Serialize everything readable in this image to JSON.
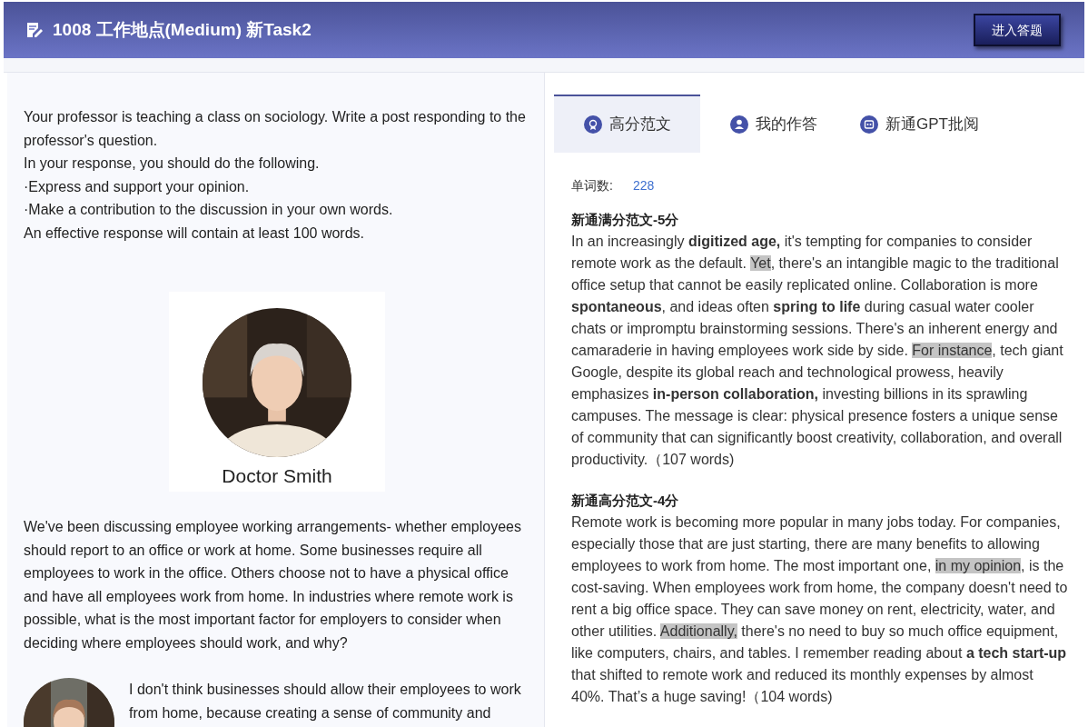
{
  "header": {
    "title": "1008 工作地点(Medium) 新Task2",
    "button": "进入答题"
  },
  "prompt": {
    "lines": [
      "Your professor is teaching a class on sociology. Write a post responding to the professor's question.",
      "In your response, you should do the following.",
      "·Express and support your opinion.",
      "·Make a contribution to the discussion in your own words.",
      "An effective response will contain at least 100 words."
    ],
    "professor": {
      "name": "Doctor Smith"
    },
    "question": "We've been discussing employee working arrangements- whether employees should report to an office or work at home. Some businesses require all employees to work in the office. Others choose not to have a physical office and have all employees work from home. In industries where remote work is possible, what is the most important factor for employers to consider when deciding where employees should work, and why?",
    "student_post": {
      "text": "I don't think businesses should allow their employees to work from home, because creating a sense of community and"
    }
  },
  "tabs": [
    {
      "label": "高分范文",
      "kind": "medal",
      "selected": true
    },
    {
      "label": "我的作答",
      "kind": "user",
      "selected": false
    },
    {
      "label": "新通GPT批阅",
      "kind": "robot",
      "selected": false
    }
  ],
  "word_count": {
    "label": "单词数:",
    "value": "228"
  },
  "essays": [
    {
      "title": "新通满分范文-5分",
      "segments": [
        {
          "kind": "text",
          "text": "In an increasingly "
        },
        {
          "kind": "bold",
          "text": "digitized age,"
        },
        {
          "kind": "text",
          "text": " it's tempting for companies to consider remote work as the default. "
        },
        {
          "kind": "highlight",
          "text": "Yet"
        },
        {
          "kind": "text",
          "text": ", there's an intangible magic to the traditional office setup that cannot be easily replicated online. Collaboration is more "
        },
        {
          "kind": "bold",
          "text": "spontaneous"
        },
        {
          "kind": "text",
          "text": ", and ideas often "
        },
        {
          "kind": "bold",
          "text": "spring to life"
        },
        {
          "kind": "text",
          "text": " during casual water cooler chats or impromptu brainstorming sessions. There's an inherent energy and camaraderie in having employees work side by side. "
        },
        {
          "kind": "highlight",
          "text": "For instance"
        },
        {
          "kind": "text",
          "text": ", tech giant Google, despite its global reach and technological prowess, heavily emphasizes "
        },
        {
          "kind": "bold",
          "text": "in-person collaboration,"
        },
        {
          "kind": "text",
          "text": " investing billions in its sprawling campuses. The message is clear: physical presence fosters a unique sense of community that can significantly boost creativity, collaboration, and overall productivity.（107 words)"
        }
      ]
    },
    {
      "title": "新通高分范文-4分",
      "segments": [
        {
          "kind": "text",
          "text": "Remote work is becoming more popular in many jobs today. For companies, especially those that are just starting, there are many benefits to allowing employees to work from home. The most important one, "
        },
        {
          "kind": "highlight",
          "text": "in my opinion"
        },
        {
          "kind": "text",
          "text": ", is the cost-saving. When employees work from home, the company doesn't need to rent a big office space. They can save money on rent, electricity, water, and other utilities. "
        },
        {
          "kind": "highlight",
          "text": "Additionally,"
        },
        {
          "kind": "text",
          "text": " there's no need to buy so much office equipment, like computers, chairs, and tables. I remember reading about "
        },
        {
          "kind": "bold",
          "text": "a tech start-up"
        },
        {
          "kind": "text",
          "text": " that shifted to remote work and reduced its monthly expenses by almost 40%. That’s a huge saving!（104 words)"
        }
      ]
    }
  ]
}
